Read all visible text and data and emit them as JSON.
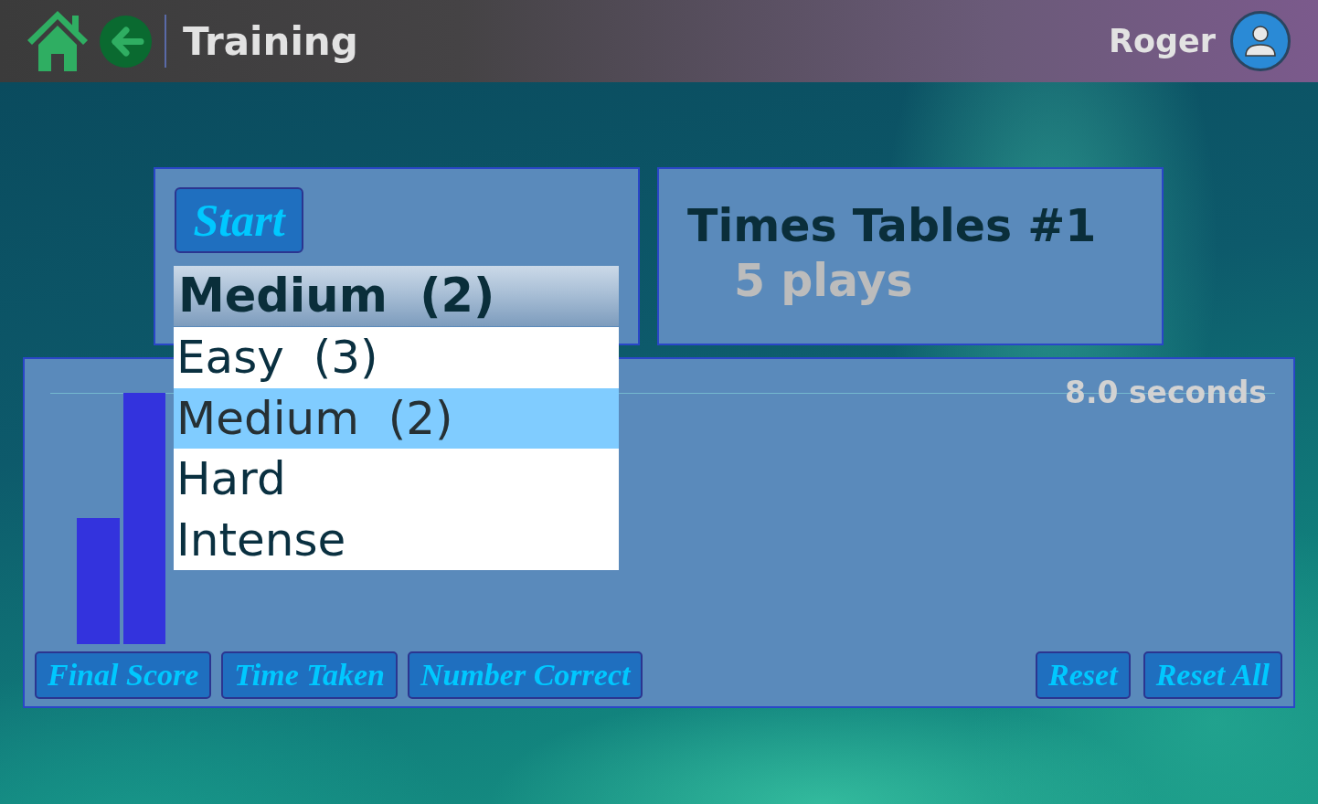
{
  "header": {
    "title": "Training",
    "user_name": "Roger"
  },
  "setup_panel": {
    "start_button": "Start",
    "difficulty_select": {
      "value": "Medium  (2)",
      "expanded": true,
      "options": [
        {
          "label": "Easy  (3)",
          "selected": false
        },
        {
          "label": "Medium  (2)",
          "selected": true
        },
        {
          "label": "Hard",
          "selected": false
        },
        {
          "label": "Intense",
          "selected": false
        }
      ]
    }
  },
  "game_panel": {
    "title": "Times Tables #1",
    "plays": "5 plays"
  },
  "results_panel": {
    "line_label": "8.0 seconds",
    "metric_buttons": [
      "Final Score",
      "Time Taken",
      "Number Correct"
    ],
    "reset_buttons": [
      "Reset",
      "Reset All"
    ]
  }
}
